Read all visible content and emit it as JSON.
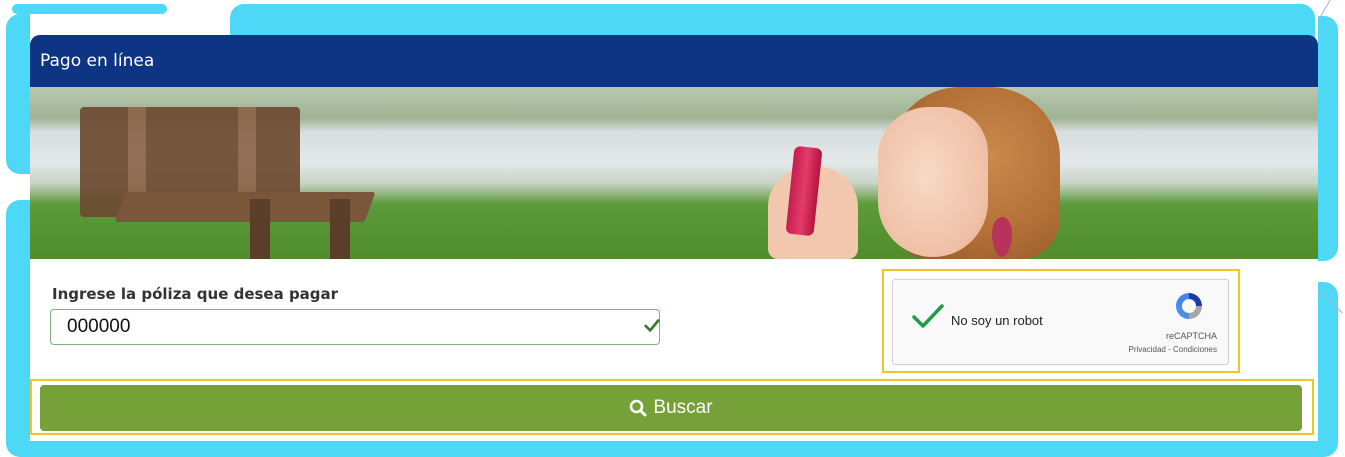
{
  "header": {
    "title": "Pago en línea"
  },
  "form": {
    "policy_label": "Ingrese la póliza que desea pagar",
    "policy_value": "000000"
  },
  "captcha": {
    "label": "No soy un robot",
    "brand": "reCAPTCHA",
    "links": "Privacidad - Condiciones"
  },
  "actions": {
    "search_label": "Buscar"
  },
  "colors": {
    "header_bg": "#0d3584",
    "button_bg": "#76a038",
    "highlight": "#f2c522",
    "frame_accent": "#4dd9f5"
  },
  "icons": {
    "search": "search-icon",
    "valid": "check-icon",
    "recaptcha": "recaptcha-logo-icon"
  }
}
